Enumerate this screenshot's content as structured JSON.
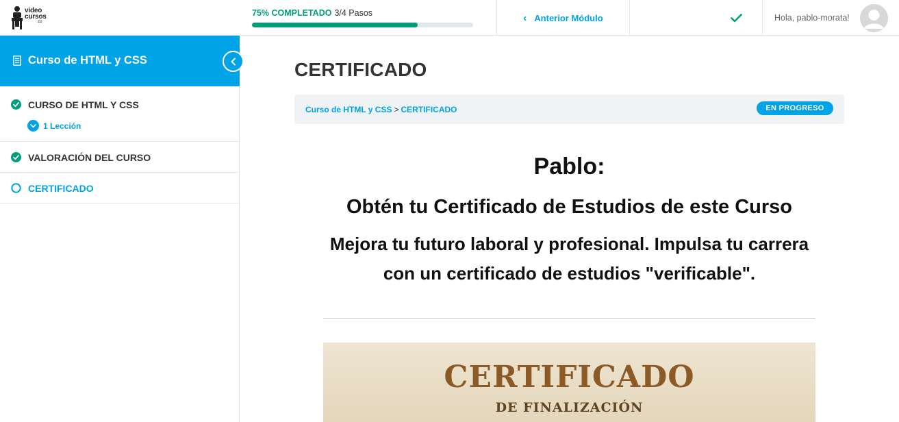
{
  "brand": {
    "logo_line1": "video",
    "logo_line2": "cursos",
    "logo_line3": ".co"
  },
  "progress": {
    "percent_label": "75% COMPLETADO",
    "steps_label": "3/4 Pasos",
    "fraction": 0.75
  },
  "topnav": {
    "prev_module_label": "Anterior Módulo",
    "mark_complete_icon": "check-icon",
    "greeting": "Hola, pablo-morata!"
  },
  "sidebar": {
    "course_title": "Curso de HTML y CSS",
    "items": [
      {
        "title": "CURSO DE HTML Y CSS",
        "status": "complete",
        "lessons_label": "1 Lección"
      },
      {
        "title": "VALORACIÓN DEL CURSO",
        "status": "complete"
      },
      {
        "title": "CERTIFICADO",
        "status": "in-progress"
      }
    ]
  },
  "main": {
    "page_title": "CERTIFICADO",
    "breadcrumb": {
      "course": "Curso de HTML y CSS",
      "separator": ">",
      "current": "CERTIFICADO"
    },
    "status_badge": "EN PROGRESO",
    "heading_name": "Pablo:",
    "heading_offer": "Obtén tu Certificado de Estudios de este Curso",
    "description": "Mejora tu futuro laboral y profesional. Impulsa tu carrera con un certificado de estudios \"verificable\".",
    "certificate": {
      "title": "CERTIFICADO",
      "subtitle": "DE FINALIZACIÓN"
    }
  },
  "colors": {
    "accent": "#00a2e8",
    "success": "#019e7c",
    "border": "#e2e7ed"
  }
}
